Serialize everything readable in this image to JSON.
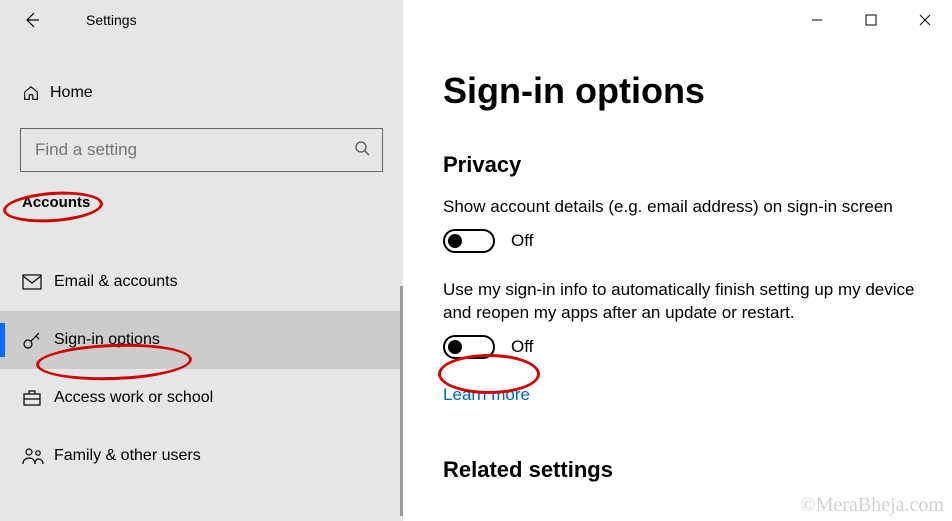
{
  "app": {
    "title": "Settings"
  },
  "sidebar": {
    "home": "Home",
    "search_placeholder": "Find a setting",
    "section": "Accounts",
    "items": [
      {
        "label": "Email & accounts"
      },
      {
        "label": "Sign-in options"
      },
      {
        "label": "Access work or school"
      },
      {
        "label": "Family & other users"
      }
    ]
  },
  "page": {
    "title": "Sign-in options",
    "privacy_head": "Privacy",
    "setting1_desc": "Show account details (e.g. email address) on sign-in screen",
    "setting1_state": "Off",
    "setting2_desc": "Use my sign-in info to automatically finish setting up my device and reopen my apps after an update or restart.",
    "setting2_state": "Off",
    "learn_more": "Learn more",
    "related_head": "Related settings"
  },
  "watermark": "©MeraBheja.com"
}
